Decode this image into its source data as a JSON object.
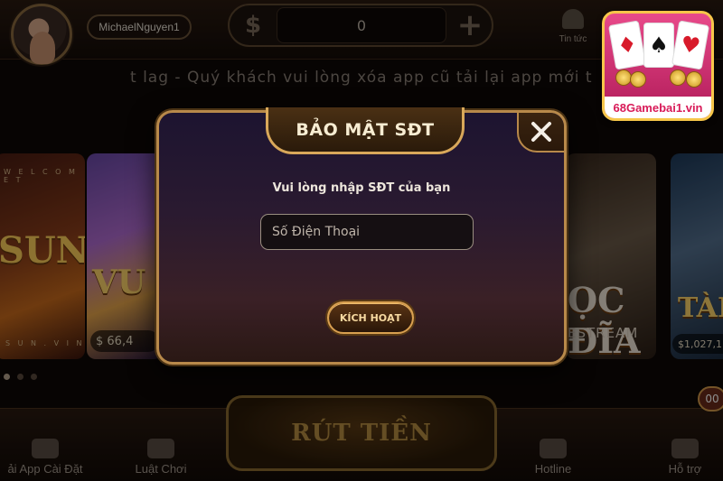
{
  "topbar": {
    "username": "MichaelNguyen1",
    "balance": "0",
    "currency_symbol": "$",
    "add_symbol": "+",
    "news_label": "Tin tức"
  },
  "marquee": {
    "text": "t lag - Quý khách vui lòng xóa app cũ tải lại app mới t"
  },
  "games": {
    "sun": {
      "welcome": "W E L C O M E  T",
      "title": "SUN",
      "footer": "S U N . V I N"
    },
    "vua": {
      "title": "VU",
      "jackpot": "$ 66,4"
    },
    "xoc": {
      "title": "ỌC ĐĨA",
      "sub": "ESTREAM"
    },
    "tai": {
      "title": "TÀI",
      "jackpot": "$1,027,11"
    }
  },
  "bottom_nav": {
    "items": [
      {
        "label": "ải App Cài Đặt",
        "icon": "download-icon"
      },
      {
        "label": "Luật Chơi",
        "icon": "rules-icon"
      },
      {
        "label": "Hotline",
        "icon": "phone-icon"
      },
      {
        "label": "Hỗ trợ",
        "icon": "chat-icon"
      }
    ],
    "withdraw_label": "RÚT TIỀN",
    "side_badge": "00"
  },
  "modal": {
    "title": "BẢO MẬT SĐT",
    "prompt": "Vui lòng nhập SĐT của bạn",
    "phone_placeholder": "Số Điện Thoại",
    "phone_value": "",
    "activate_label": "KÍCH HOẠT",
    "close_symbol": "✕"
  },
  "watermark": {
    "site": "68Gamebai1.vin",
    "card_symbols": [
      "♦",
      "♠",
      "♥"
    ]
  },
  "colors": {
    "accent_gold": "#d9a85a",
    "modal_bg": "#2a1a30",
    "logo_pink": "#e84a8a"
  }
}
